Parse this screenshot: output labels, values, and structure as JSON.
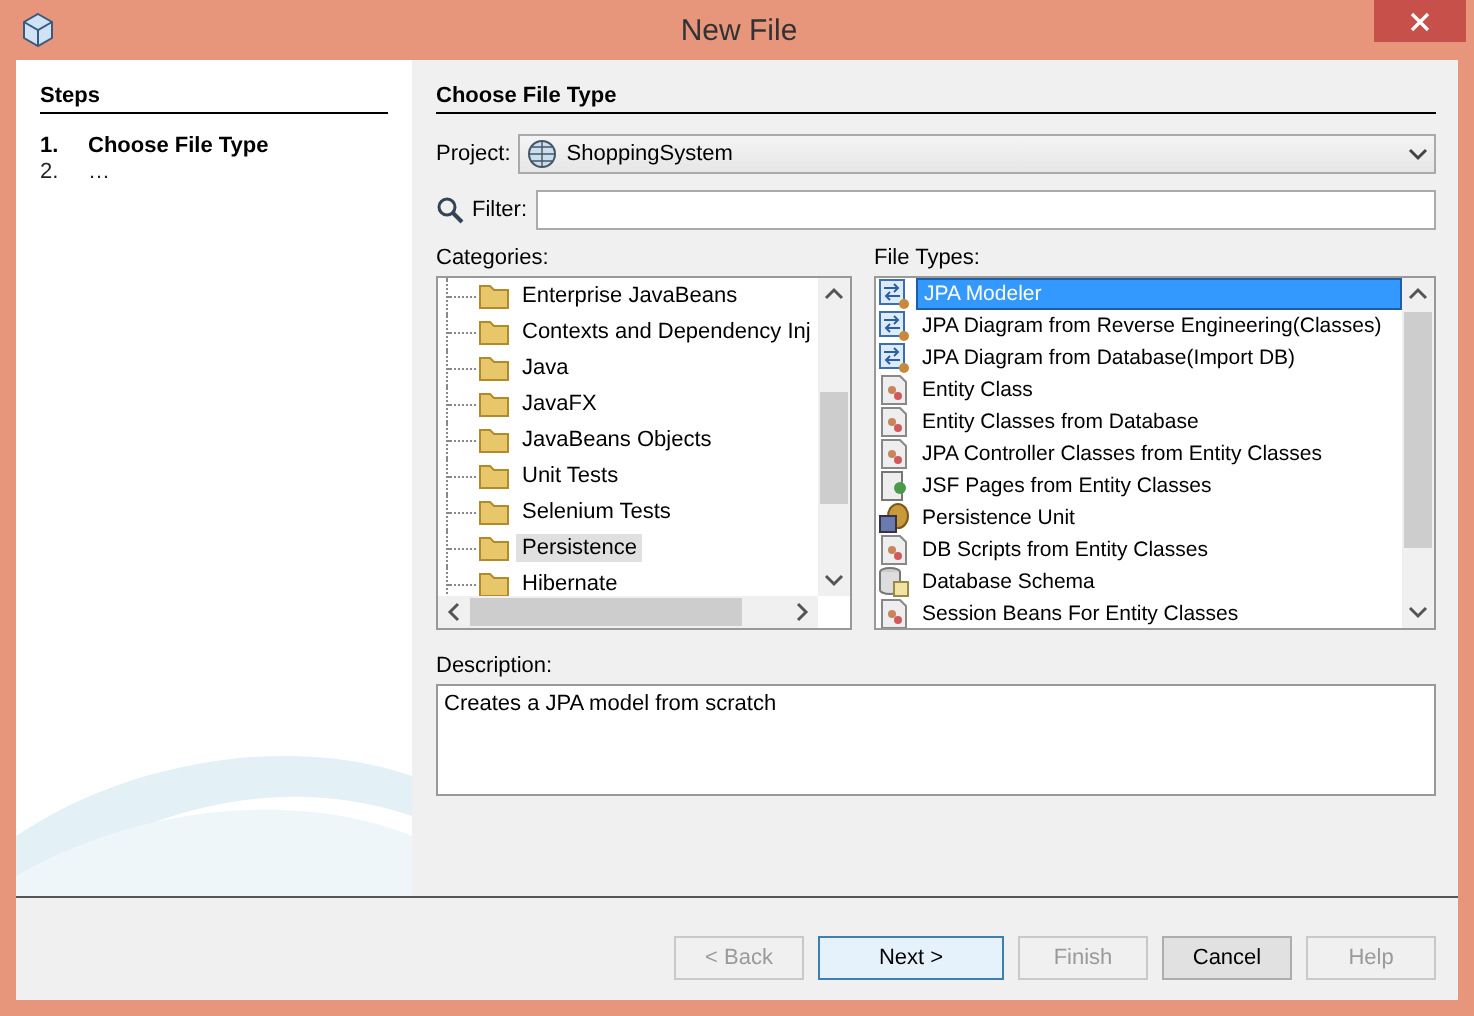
{
  "window": {
    "title": "New File"
  },
  "steps": {
    "heading": "Steps",
    "items": [
      {
        "number": "1.",
        "label": "Choose File Type",
        "selected": true
      },
      {
        "number": "2.",
        "label": "…",
        "selected": false
      }
    ]
  },
  "main": {
    "heading": "Choose File Type",
    "project": {
      "label": "Project:",
      "value": "ShoppingSystem"
    },
    "filter": {
      "label": "Filter:"
    },
    "categories": {
      "label": "Categories:",
      "items": [
        {
          "label": "Enterprise JavaBeans",
          "selected": false
        },
        {
          "label": "Contexts and Dependency Inj",
          "selected": false
        },
        {
          "label": "Java",
          "selected": false
        },
        {
          "label": "JavaFX",
          "selected": false
        },
        {
          "label": "JavaBeans Objects",
          "selected": false
        },
        {
          "label": "Unit Tests",
          "selected": false
        },
        {
          "label": "Selenium Tests",
          "selected": false
        },
        {
          "label": "Persistence",
          "selected": true
        },
        {
          "label": "Hibernate",
          "selected": false
        }
      ]
    },
    "file_types": {
      "label": "File Types:",
      "items": [
        {
          "label": "JPA Modeler",
          "kind": "diagram",
          "selected": true
        },
        {
          "label": "JPA Diagram from Reverse Engineering(Classes)",
          "kind": "diagram",
          "selected": false
        },
        {
          "label": "JPA Diagram from Database(Import DB)",
          "kind": "diagram",
          "selected": false
        },
        {
          "label": "Entity Class",
          "kind": "entity",
          "selected": false
        },
        {
          "label": "Entity Classes from Database",
          "kind": "entity",
          "selected": false
        },
        {
          "label": "JPA Controller Classes from Entity Classes",
          "kind": "entity",
          "selected": false
        },
        {
          "label": "JSF Pages from Entity Classes",
          "kind": "page",
          "selected": false
        },
        {
          "label": "Persistence Unit",
          "kind": "unit",
          "selected": false
        },
        {
          "label": "DB Scripts from Entity Classes",
          "kind": "entity",
          "selected": false
        },
        {
          "label": "Database Schema",
          "kind": "database",
          "selected": false
        },
        {
          "label": "Session Beans For Entity Classes",
          "kind": "entity",
          "selected": false
        }
      ]
    },
    "description": {
      "label": "Description:",
      "text": "Creates a JPA model from scratch"
    }
  },
  "buttons": [
    {
      "label": "< Back",
      "disabled": true,
      "default": false
    },
    {
      "label": "Next >",
      "disabled": false,
      "default": true
    },
    {
      "label": "Finish",
      "disabled": true,
      "default": false
    },
    {
      "label": "Cancel",
      "disabled": false,
      "default": false
    },
    {
      "label": "Help",
      "disabled": true,
      "default": false
    }
  ]
}
